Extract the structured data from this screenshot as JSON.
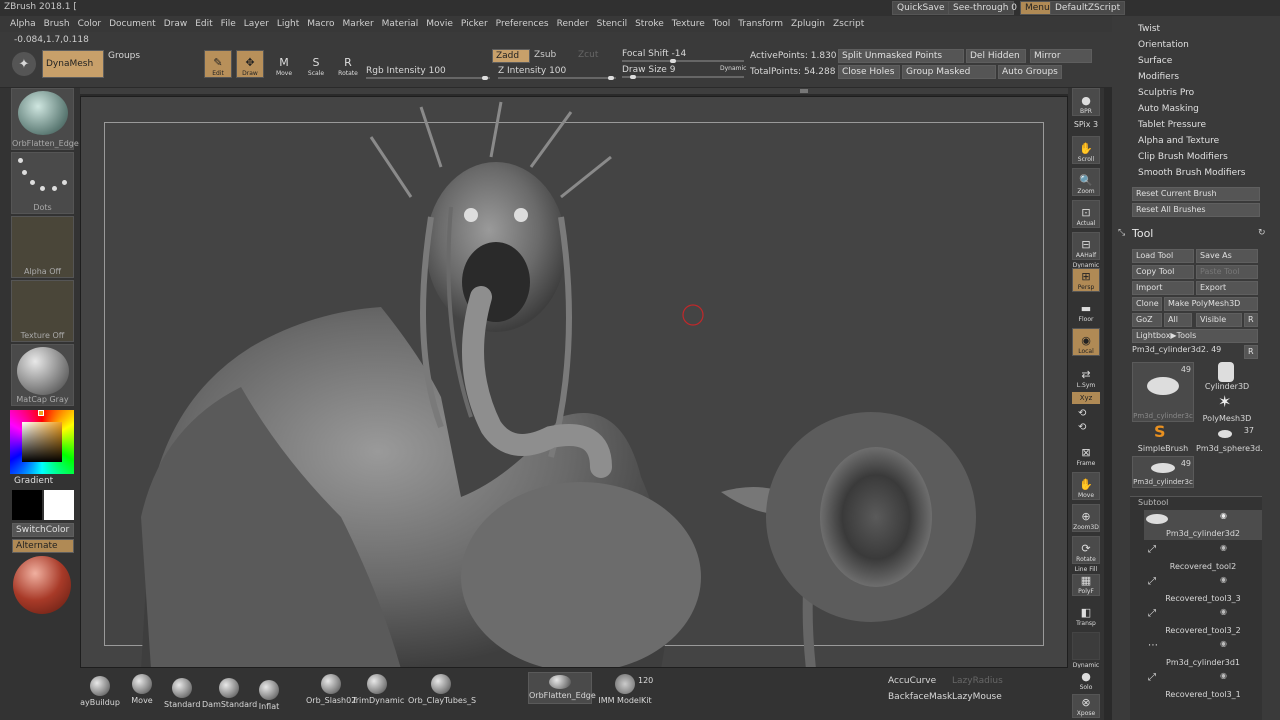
{
  "app": {
    "title": "ZBrush 2018.1 ["
  },
  "menubar": [
    "Alpha",
    "Brush",
    "Color",
    "Document",
    "Draw",
    "Edit",
    "File",
    "Layer",
    "Light",
    "Macro",
    "Marker",
    "Material",
    "Movie",
    "Picker",
    "Preferences",
    "Render",
    "Stencil",
    "Stroke",
    "Texture",
    "Tool",
    "Transform",
    "Zplugin",
    "Zscript"
  ],
  "topright": {
    "quicksave": "QuickSave",
    "seethrough": "See-through",
    "seethrough_value": "0",
    "menus": "Menus",
    "defaultzscript": "DefaultZScript"
  },
  "shelf": {
    "coords": "-0.084,1.7,0.118",
    "dynamesh": "DynaMesh",
    "groups": "Groups",
    "tools": [
      {
        "label": "Edit",
        "glyph": "✎",
        "active": true
      },
      {
        "label": "Draw",
        "glyph": "✥",
        "active": true
      },
      {
        "label": "Move",
        "glyph": "M",
        "active": false
      },
      {
        "label": "Scale",
        "glyph": "S",
        "active": false
      },
      {
        "label": "Rotate",
        "glyph": "R",
        "active": false
      }
    ],
    "rgb_intensity_label": "Rgb Intensity",
    "rgb_intensity_value": "100",
    "zadd": "Zadd",
    "zsub": "Zsub",
    "zcut": "Zcut",
    "z_intensity_label": "Z Intensity",
    "z_intensity_value": "100",
    "focal_shift_label": "Focal Shift",
    "focal_shift_value": "-14",
    "draw_size_label": "Draw Size",
    "draw_size_value": "9",
    "dynamic": "Dynamic",
    "active_points": "ActivePoints: 1.830 Mil",
    "total_points": "TotalPoints: 54.288 Mil",
    "split_unmasked": "Split Unmasked Points",
    "del_hidden": "Del Hidden",
    "mirror": "Mirror",
    "close_holes": "Close Holes",
    "group_masked": "Group Masked",
    "auto_groups": "Auto Groups"
  },
  "lefttray": {
    "brush_label": "OrbFlatten_Edge",
    "stroke_label": "Dots",
    "alpha_label": "Alpha Off",
    "texture_label": "Texture Off",
    "material_label": "MatCap Gray",
    "gradient": "Gradient",
    "switchcolor": "SwitchColor",
    "alternate": "Alternate"
  },
  "rightshelf": {
    "items": [
      {
        "label": "BPR",
        "glyph": "●"
      },
      {
        "label": "SPix 3",
        "glyph": ""
      },
      {
        "label": "Scroll",
        "glyph": "✋"
      },
      {
        "label": "Zoom",
        "glyph": "🔍"
      },
      {
        "label": "Actual",
        "glyph": "⊡"
      },
      {
        "label": "AAHalf",
        "glyph": "⊟"
      },
      {
        "label": "Persp",
        "glyph": "⊞"
      },
      {
        "label": "Floor",
        "glyph": "▬"
      },
      {
        "label": "Local",
        "glyph": "◉"
      },
      {
        "label": "L.Sym",
        "glyph": "⇄"
      },
      {
        "label": "Xyz",
        "glyph": ""
      },
      {
        "label": "Frame",
        "glyph": "⊠"
      },
      {
        "label": "Move",
        "glyph": "✋"
      },
      {
        "label": "Zoom3D",
        "glyph": "⊕"
      },
      {
        "label": "Rotate",
        "glyph": "⟳"
      },
      {
        "label": "PolyF",
        "glyph": "▦"
      },
      {
        "label": "Transp",
        "glyph": "◧"
      },
      {
        "label": "Solo",
        "glyph": "●"
      },
      {
        "label": "Xpose",
        "glyph": "⊗"
      }
    ],
    "dynamic": "Dynamic",
    "line_fill": "Line Fill"
  },
  "rightpanel": {
    "menu": [
      "Twist",
      "Orientation",
      "Surface",
      "Modifiers",
      "Sculptris Pro",
      "Auto Masking",
      "Tablet Pressure",
      "Alpha and Texture",
      "Clip Brush Modifiers",
      "Smooth Brush Modifiers"
    ],
    "reset_current": "Reset Current Brush",
    "reset_all": "Reset All Brushes",
    "tool_title": "Tool",
    "load_tool": "Load Tool",
    "save_as": "Save As",
    "copy_tool": "Copy Tool",
    "paste_tool": "Paste Tool",
    "import": "Import",
    "export": "Export",
    "clone": "Clone",
    "make_polymesh": "Make PolyMesh3D",
    "goz": "GoZ",
    "all": "All",
    "visible": "Visible",
    "r": "R",
    "lightbox_tools": "Lightbox▶Tools",
    "current_tool": "Pm3d_cylinder3d2.",
    "current_tool_count": "49",
    "thumbs": [
      {
        "label": "Pm3d_cylinder3c",
        "count": "49"
      },
      {
        "label": "Cylinder3D",
        "count": ""
      },
      {
        "label": "PolyMesh3D",
        "count": ""
      },
      {
        "label": "SimpleBrush",
        "count": ""
      },
      {
        "label": "Pm3d_sphere3d.",
        "count": "37"
      },
      {
        "label": "Pm3d_cylinder3c",
        "count": "49"
      }
    ],
    "subtool_title": "Subtool",
    "subtools": [
      "Pm3d_cylinder3d2",
      "Recovered_tool2",
      "Recovered_tool3_3",
      "Recovered_tool3_2",
      "Pm3d_cylinder3d1",
      "Recovered_tool3_1"
    ]
  },
  "bottomtray": {
    "brushes": [
      "ayBuildup",
      "Move",
      "Standard",
      "DamStandard",
      "Inflat",
      "Orb_Slash02",
      "TrimDynamic",
      "Orb_ClayTubes_S"
    ],
    "current_brush": "OrbFlatten_Edge",
    "imm": "IMM ModelKit",
    "imm_count": "120",
    "accucurve": "AccuCurve",
    "lazyradius": "LazyRadius",
    "backfacemask": "BackfaceMask",
    "lazymouse": "LazyMouse"
  }
}
